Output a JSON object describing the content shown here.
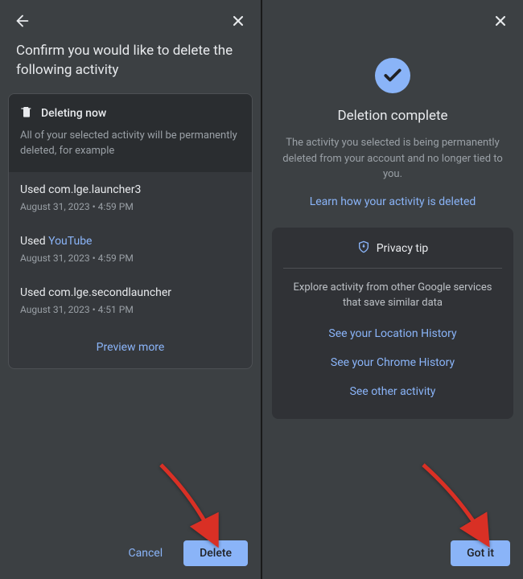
{
  "left": {
    "title": "Confirm you would like to delete the following activity",
    "deleting": {
      "header": "Deleting now",
      "desc": "All of your selected activity will be permanently deleted, for example"
    },
    "items": [
      {
        "prefix": "Used ",
        "name": "com.lge.launcher3",
        "is_link": false,
        "time": "August 31, 2023 • 4:59 PM"
      },
      {
        "prefix": "Used ",
        "name": "YouTube",
        "is_link": true,
        "time": "August 31, 2023 • 4:59 PM"
      },
      {
        "prefix": "Used ",
        "name": "com.lge.secondlauncher",
        "is_link": false,
        "time": "August 31, 2023 • 4:51 PM"
      }
    ],
    "preview_more": "Preview more",
    "cancel": "Cancel",
    "delete": "Delete"
  },
  "right": {
    "title": "Deletion complete",
    "desc": "The activity you selected is being permanently deleted from your account and no longer tied to you.",
    "learn": "Learn how your activity is deleted",
    "tip": {
      "header": "Privacy tip",
      "desc": "Explore activity from other Google services that save similar data",
      "links": [
        "See your Location History",
        "See your Chrome History",
        "See other activity"
      ]
    },
    "got_it": "Got it"
  }
}
